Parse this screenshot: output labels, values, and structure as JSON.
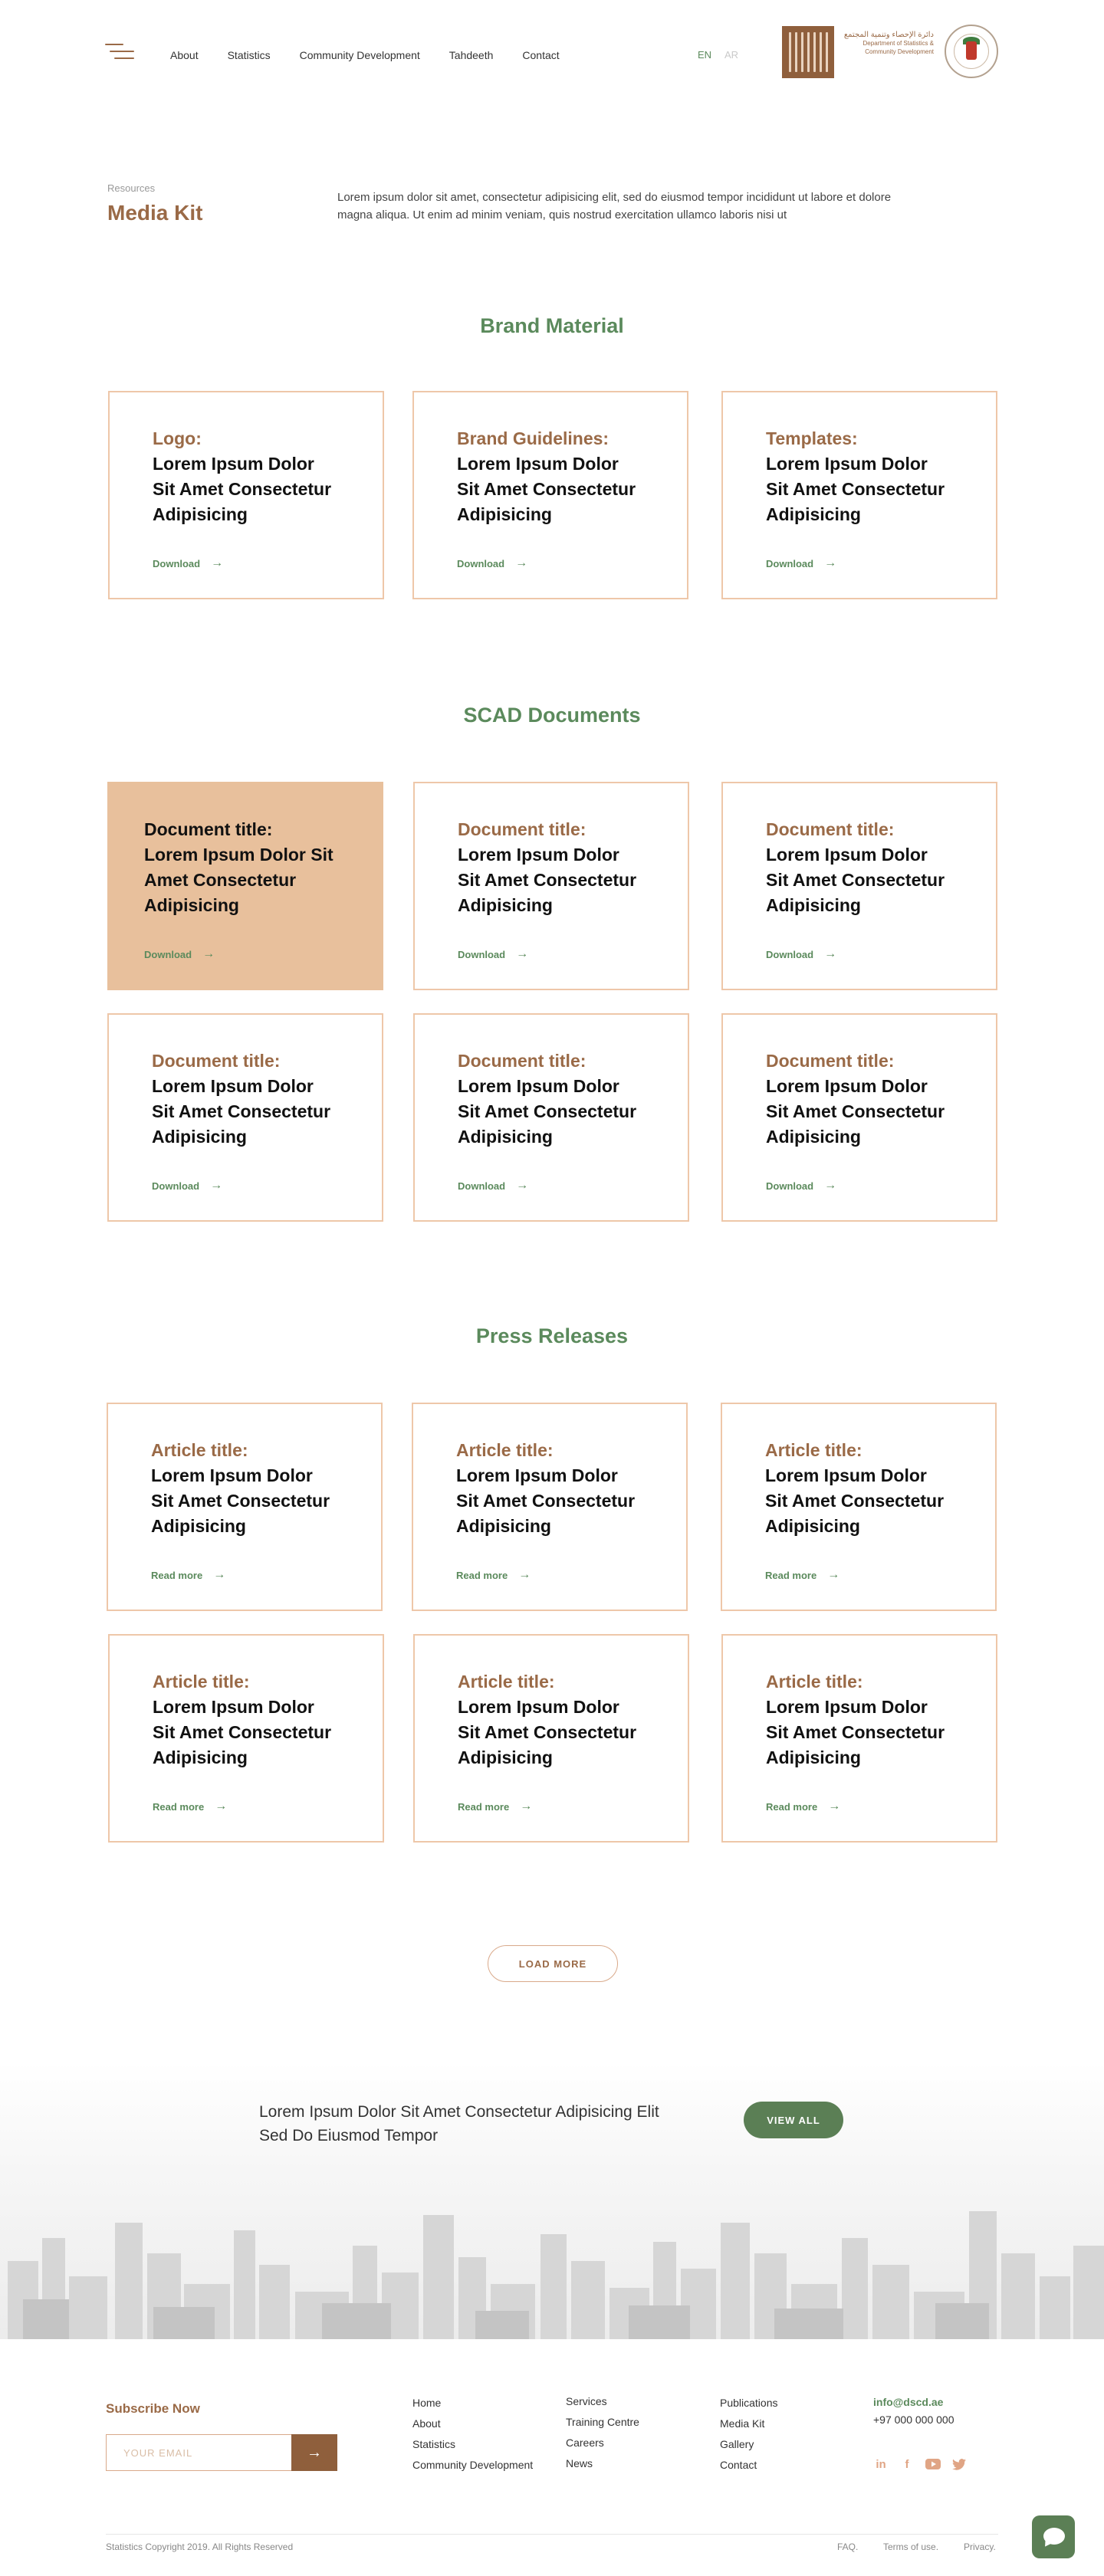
{
  "header": {
    "nav": [
      "About",
      "Statistics",
      "Community Development",
      "Tahdeeth",
      "Contact"
    ],
    "lang_en": "EN",
    "lang_ar": "AR",
    "logo_text_ar": "دائرة الإحصاء وتنمية المجتمع",
    "logo_text_en": "Department of Statistics & Community Development"
  },
  "intro": {
    "breadcrumb": "Resources",
    "title": "Media Kit",
    "description": "Lorem ipsum dolor sit amet, consectetur adipisicing elit, sed do eiusmod tempor incididunt ut labore et dolore magna aliqua. Ut enim ad minim veniam, quis nostrud exercitation ullamco laboris nisi ut"
  },
  "brand": {
    "heading": "Brand Material",
    "cards": [
      {
        "label": "Logo:",
        "text": "Lorem Ipsum Dolor Sit Amet Consectetur Adipisicing",
        "link": "Download"
      },
      {
        "label": "Brand Guidelines:",
        "text": "Lorem Ipsum Dolor Sit Amet Consectetur Adipisicing",
        "link": "Download"
      },
      {
        "label": "Templates:",
        "text": "Lorem Ipsum Dolor Sit Amet Consectetur Adipisicing",
        "link": "Download"
      }
    ]
  },
  "documents": {
    "heading": "SCAD Documents",
    "cards": [
      {
        "label": "Document title:",
        "text": "Lorem Ipsum Dolor Sit Amet Consectetur Adipisicing",
        "link": "Download"
      },
      {
        "label": "Document title:",
        "text": "Lorem Ipsum Dolor Sit Amet Consectetur Adipisicing",
        "link": "Download"
      },
      {
        "label": "Document title:",
        "text": "Lorem Ipsum Dolor Sit Amet Consectetur Adipisicing",
        "link": "Download"
      },
      {
        "label": "Document title:",
        "text": "Lorem Ipsum Dolor Sit Amet Consectetur Adipisicing",
        "link": "Download"
      },
      {
        "label": "Document title:",
        "text": "Lorem Ipsum Dolor Sit Amet Consectetur Adipisicing",
        "link": "Download"
      },
      {
        "label": "Document title:",
        "text": "Lorem Ipsum Dolor Sit Amet Consectetur Adipisicing",
        "link": "Download"
      }
    ]
  },
  "press": {
    "heading": "Press Releases",
    "cards": [
      {
        "label": "Article title:",
        "text": "Lorem Ipsum Dolor Sit Amet Consectetur Adipisicing",
        "link": "Read more"
      },
      {
        "label": "Article title:",
        "text": "Lorem Ipsum Dolor Sit Amet Consectetur Adipisicing",
        "link": "Read more"
      },
      {
        "label": "Article title:",
        "text": "Lorem Ipsum Dolor Sit Amet Consectetur Adipisicing",
        "link": "Read more"
      },
      {
        "label": "Article title:",
        "text": "Lorem Ipsum Dolor Sit Amet Consectetur Adipisicing",
        "link": "Read more"
      },
      {
        "label": "Article title:",
        "text": "Lorem Ipsum Dolor Sit Amet Consectetur Adipisicing",
        "link": "Read more"
      },
      {
        "label": "Article title:",
        "text": "Lorem Ipsum Dolor Sit Amet Consectetur Adipisicing",
        "link": "Read more"
      }
    ],
    "load_more": "LOAD MORE"
  },
  "banner": {
    "text": "Lorem Ipsum Dolor Sit Amet Consectetur Adipisicing Elit Sed Do Eiusmod Tempor",
    "button": "VIEW ALL"
  },
  "footer": {
    "subscribe_heading": "Subscribe Now",
    "email_placeholder": "YOUR EMAIL",
    "col1": [
      "Home",
      "About",
      "Statistics",
      "Community Development"
    ],
    "col2": [
      "Services",
      "Training Centre",
      "Careers",
      "News"
    ],
    "col3": [
      "Publications",
      "Media Kit",
      "Gallery",
      "Contact"
    ],
    "email": "info@dscd.ae",
    "phone": "+97 000 000 000",
    "socials": [
      "linkedin-icon",
      "facebook-icon",
      "youtube-icon",
      "twitter-icon"
    ],
    "copyright": "Statistics Copyright 2019. All Rights Reserved",
    "legal": [
      "FAQ.",
      "Terms of use.",
      "Privacy."
    ]
  },
  "colors": {
    "brown": "#9a6a47",
    "green": "#5b8a5c",
    "peach": "#e8c09c",
    "border": "#eec7a9"
  }
}
